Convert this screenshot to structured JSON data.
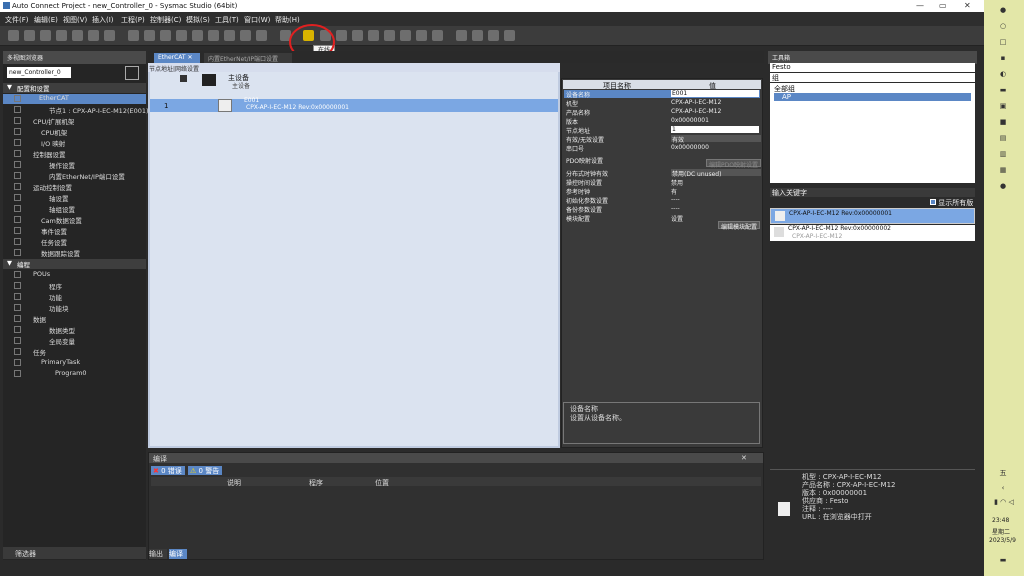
{
  "window": {
    "title": "Auto Connect Project - new_Controller_0 - Sysmac Studio (64bit)"
  },
  "menu": [
    "文件(F)",
    "编辑(E)",
    "视图(V)",
    "插入(I)",
    "工程(P)",
    "控制器(C)",
    "模拟(S)",
    "工具(T)",
    "窗口(W)",
    "帮助(H)"
  ],
  "toolbar": {
    "tooltip": "在线"
  },
  "left": {
    "title": "多视图浏览器",
    "controller": "new_Controller_0",
    "items": [
      "配置和设置",
      "EtherCAT",
      "节点1 : CPX-AP-I-EC-M12(E001)",
      "CPU/扩展机架",
      "CPU机架",
      "I/O 映射",
      "控制器设置",
      "操作设置",
      "内置EtherNet/IP端口设置",
      "运动控制设置",
      "轴设置",
      "轴组设置",
      "Cam数据设置",
      "事件设置",
      "任务设置",
      "数据跟踪设置",
      "编程",
      "POUs",
      "程序",
      "功能",
      "功能块",
      "数据",
      "数据类型",
      "全局变量",
      "任务",
      "PrimaryTask",
      "Program0"
    ],
    "filter": "筛选器"
  },
  "tabs": {
    "t1": "EtherCAT",
    "t2": "内置EtherNet/IP端口设置"
  },
  "editor": {
    "header": "节点地址|网络设置",
    "master": "主设备",
    "master_sub": "主设备",
    "row_num": "1",
    "device_id": "E001",
    "device_name": "CPX-AP-I-EC-M12 Rev:0x00000001"
  },
  "props": {
    "col1": "项目名称",
    "col2": "值",
    "rows": [
      {
        "k": "设备名称",
        "v": "E001"
      },
      {
        "k": "机型",
        "v": "CPX-AP-I-EC-M12"
      },
      {
        "k": "产品名称",
        "v": "CPX-AP-I-EC-M12"
      },
      {
        "k": "版本",
        "v": "0x00000001"
      },
      {
        "k": "节点地址",
        "v": "1"
      },
      {
        "k": "有效/无效设置",
        "v": "有效"
      },
      {
        "k": "串口号",
        "v": "0x00000000"
      },
      {
        "k": "PDO映射设置",
        "v": ""
      },
      {
        "k": "分布式时钟有效",
        "v": "禁用(DC unused)"
      },
      {
        "k": "操控时间设置",
        "v": "禁用"
      },
      {
        "k": "参考时钟",
        "v": "有"
      },
      {
        "k": "初始化参数设置",
        "v": "----"
      },
      {
        "k": "备份参数设置",
        "v": "----"
      },
      {
        "k": "模块配置",
        "v": "设置"
      }
    ],
    "pdo_button": "编辑PDO映射设置",
    "module_button": "编辑模块配置",
    "desc_title": "设备名称",
    "desc_text": "设置从设备名称。"
  },
  "output": {
    "title": "编译",
    "errors": "0 错误",
    "warnings": "0 警告",
    "cols": [
      "说明",
      "程序",
      "位置"
    ],
    "tabs": [
      "输出",
      "编译"
    ]
  },
  "right": {
    "title": "工具箱",
    "vendor": "Festo",
    "group_label": "组",
    "groups": [
      "全部组",
      "AP"
    ],
    "keyword_label": "输入关键字",
    "show_all": "显示所有版本",
    "devices": [
      {
        "name": "CPX-AP-I-EC-M12 Rev:0x00000001",
        "sub": ""
      },
      {
        "name": "CPX-AP-I-EC-M12 Rev:0x00000002",
        "sub": "CPX-AP-I-EC-M12"
      }
    ],
    "info": {
      "model": "机型 : CPX-AP-I-EC-M12",
      "product": "产品名称 : CPX-AP-I-EC-M12",
      "version": "版本 : 0x00000001",
      "vendor": "供应商 : Festo",
      "note": "注释 : ----",
      "url": "URL : 在浏览器中打开"
    }
  },
  "tray": {
    "time": "23:48",
    "weekday": "星期二",
    "date": "2023/5/9"
  },
  "colors": {
    "accent": "#5b87c5",
    "annotation": "#e02020",
    "online": "#d8b300"
  }
}
